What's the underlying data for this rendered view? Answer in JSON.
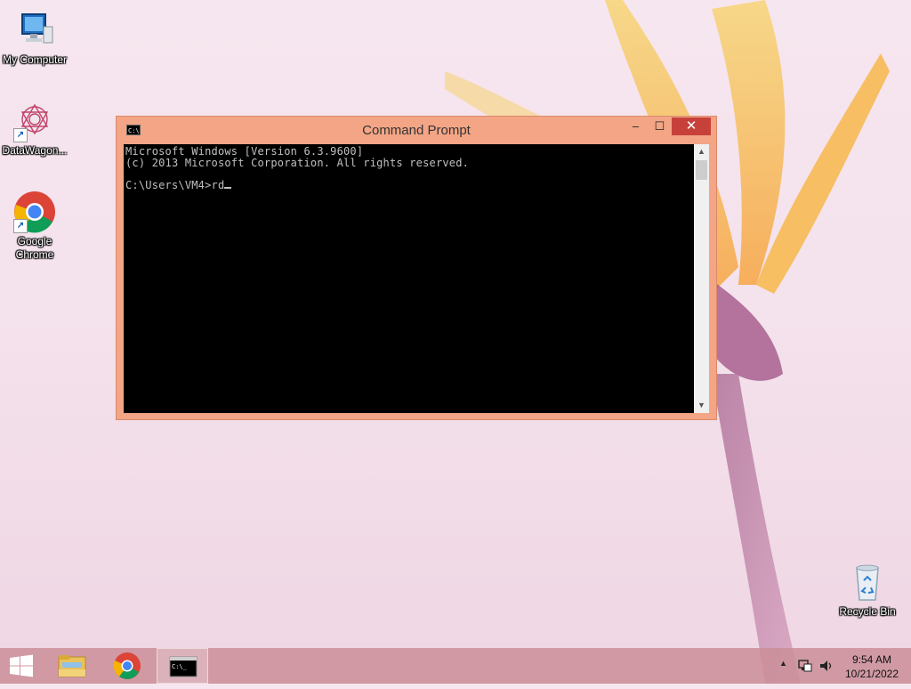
{
  "desktop": {
    "icons": [
      {
        "label": "My Computer"
      },
      {
        "label": "DataWagon..."
      },
      {
        "label": "Google Chrome"
      },
      {
        "label": "Recycle Bin"
      }
    ]
  },
  "window": {
    "title": "Command Prompt",
    "icon_text": "C:\\",
    "controls": {
      "minimize": "–",
      "maximize": "☐",
      "close": "✕"
    },
    "console_lines": [
      "Microsoft Windows [Version 6.3.9600]",
      "(c) 2013 Microsoft Corporation. All rights reserved.",
      "",
      "C:\\Users\\VM4>rd"
    ]
  },
  "taskbar": {
    "items": [
      "start-button",
      "file-explorer",
      "chrome",
      "command-prompt"
    ],
    "active": "command-prompt",
    "clock": {
      "time": "9:54 AM",
      "date": "10/21/2022"
    }
  },
  "colors": {
    "window_frame": "#f3a585",
    "close_button": "#c7413a",
    "console_bg": "#000000",
    "console_fg": "#c0c0c0"
  }
}
